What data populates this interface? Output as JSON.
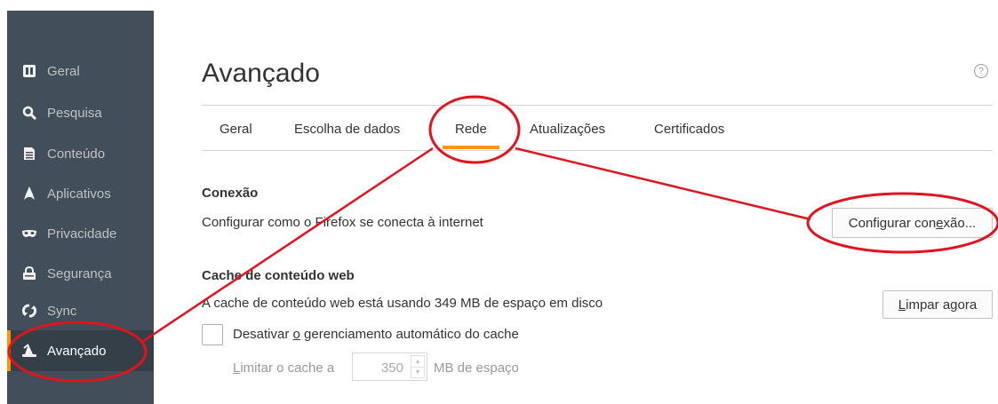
{
  "sidebar": {
    "items": [
      {
        "label": "Geral",
        "icon": "general-icon"
      },
      {
        "label": "Pesquisa",
        "icon": "search-icon"
      },
      {
        "label": "Conteúdo",
        "icon": "document-icon"
      },
      {
        "label": "Aplicativos",
        "icon": "rocket-icon"
      },
      {
        "label": "Privacidade",
        "icon": "mask-icon"
      },
      {
        "label": "Segurança",
        "icon": "lock-icon"
      },
      {
        "label": "Sync",
        "icon": "sync-icon"
      },
      {
        "label": "Avançado",
        "icon": "wizard-hat-icon",
        "active": true
      }
    ]
  },
  "main": {
    "title": "Avançado",
    "help_icon": "?",
    "tabs": [
      {
        "label": "Geral"
      },
      {
        "label": "Escolha de dados"
      },
      {
        "label": "Rede",
        "active": true
      },
      {
        "label": "Atualizações"
      },
      {
        "label": "Certificados"
      }
    ]
  },
  "connection": {
    "title": "Conexão",
    "description": "Configurar como o Firefox se conecta à internet",
    "button_prefix": "Configurar con",
    "button_access_key": "e",
    "button_suffix": "xão..."
  },
  "cache": {
    "title": "Cache de conteúdo web",
    "description": "A cache de conteúdo web está usando 349 MB de espaço em disco",
    "clear_button_access_key": "L",
    "clear_button_rest": "impar agora",
    "override_prefix": "Desativar ",
    "override_access_key": "o",
    "override_suffix": " gerenciamento automático do cache",
    "limit_access_key": "L",
    "limit_rest": "imitar o cache a",
    "limit_value": "350",
    "limit_unit": "MB de espaço"
  },
  "colors": {
    "accent": "#ff9500",
    "sidebar_bg": "#424f5a",
    "annotation": "#e0141e"
  }
}
